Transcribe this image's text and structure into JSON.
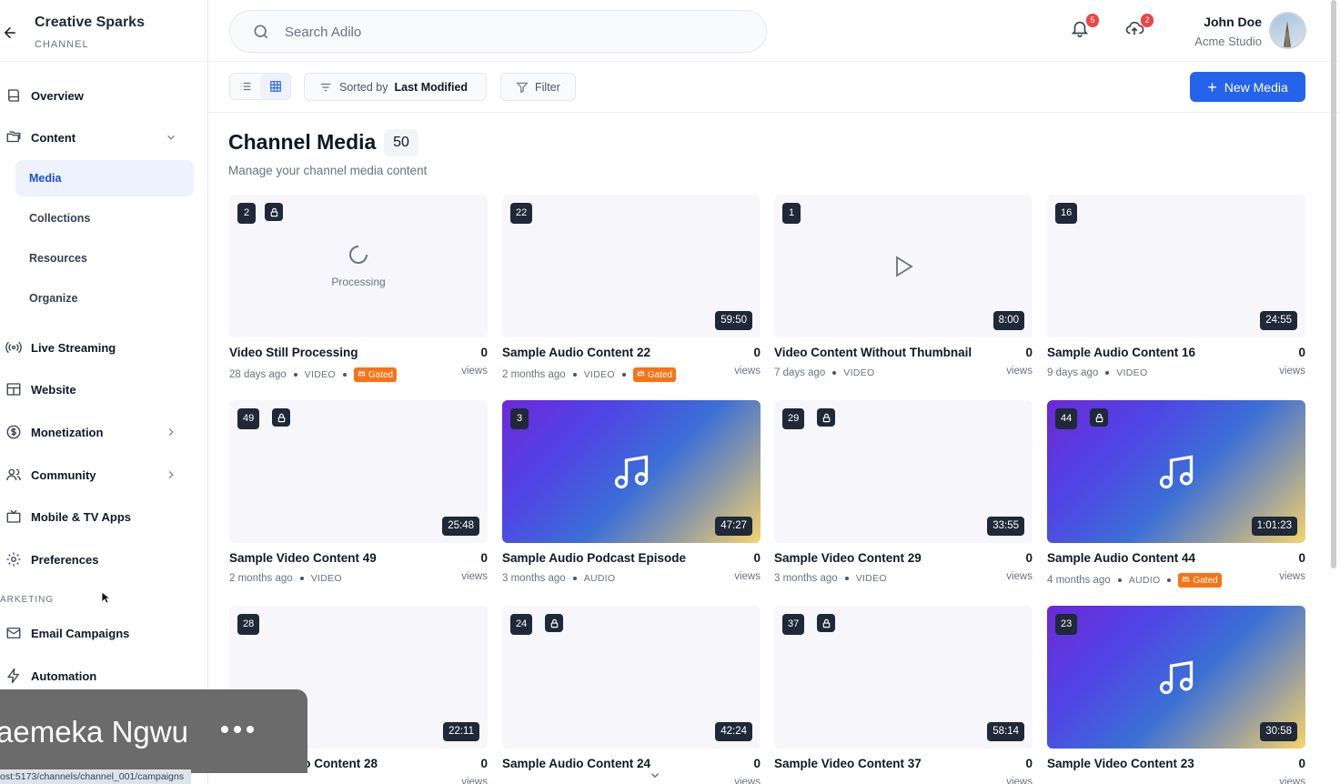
{
  "sidebar": {
    "brand_title": "Creative Sparks",
    "brand_sub": "CHANNEL",
    "items": [
      {
        "label": "Overview",
        "icon": "book-icon"
      },
      {
        "label": "Content",
        "icon": "folders-icon"
      },
      {
        "label": "Live Streaming",
        "icon": "broadcast-icon"
      },
      {
        "label": "Website",
        "icon": "layout-icon"
      },
      {
        "label": "Monetization",
        "icon": "dollar-icon"
      },
      {
        "label": "Community",
        "icon": "users-icon"
      },
      {
        "label": "Mobile & TV Apps",
        "icon": "tv-icon"
      },
      {
        "label": "Preferences",
        "icon": "gear-icon"
      },
      {
        "label": "Email Campaigns",
        "icon": "mail-icon"
      },
      {
        "label": "Automation",
        "icon": "bolt-icon"
      }
    ],
    "content_sub": [
      "Media",
      "Collections",
      "Resources",
      "Organize"
    ],
    "section_marketing": "ARKETING"
  },
  "header": {
    "search_placeholder": "Search Adilo",
    "notifications_count": "5",
    "uploads_count": "2",
    "user_name": "John Doe",
    "user_org": "Acme Studio"
  },
  "toolbar": {
    "sort_prefix": "Sorted by",
    "sort_value": "Last Modified",
    "filter_label": "Filter",
    "new_media_label": "New Media"
  },
  "main": {
    "title": "Channel Media",
    "count": "50",
    "subtitle": "Manage your channel media content",
    "views_label": "views",
    "processing_label": "Processing",
    "gated_label": "Gated"
  },
  "media": [
    {
      "num": "2",
      "title": "Video Still Processing",
      "views": "0",
      "age": "28 days ago",
      "type": "VIDEO",
      "gated": true,
      "locked": true,
      "duration": "",
      "thumb": "processing"
    },
    {
      "num": "22",
      "title": "Sample Audio Content 22",
      "views": "0",
      "age": "2 months ago",
      "type": "VIDEO",
      "gated": true,
      "locked": false,
      "duration": "59:50",
      "thumb": "blank"
    },
    {
      "num": "1",
      "title": "Video Content Without Thumbnail",
      "views": "0",
      "age": "7 days ago",
      "type": "VIDEO",
      "gated": false,
      "locked": false,
      "duration": "8:00",
      "thumb": "play"
    },
    {
      "num": "16",
      "title": "Sample Audio Content 16",
      "views": "0",
      "age": "9 days ago",
      "type": "VIDEO",
      "gated": false,
      "locked": false,
      "duration": "24:55",
      "thumb": "blank"
    },
    {
      "num": "49",
      "title": "Sample Video Content 49",
      "views": "0",
      "age": "2 months ago",
      "type": "VIDEO",
      "gated": false,
      "locked": true,
      "duration": "25:48",
      "thumb": "blank"
    },
    {
      "num": "3",
      "title": "Sample Audio Podcast Episode",
      "views": "0",
      "age": "3 months ago",
      "type": "AUDIO",
      "gated": false,
      "locked": false,
      "duration": "47:27",
      "thumb": "audio"
    },
    {
      "num": "29",
      "title": "Sample Video Content 29",
      "views": "0",
      "age": "3 months ago",
      "type": "VIDEO",
      "gated": false,
      "locked": true,
      "duration": "33:55",
      "thumb": "blank"
    },
    {
      "num": "44",
      "title": "Sample Audio Content 44",
      "views": "0",
      "age": "4 months ago",
      "type": "AUDIO",
      "gated": true,
      "locked": true,
      "duration": "1:01:23",
      "thumb": "audio"
    },
    {
      "num": "28",
      "title": "Sample Audio Content 28",
      "views": "0",
      "age": "",
      "type": "",
      "gated": false,
      "locked": false,
      "duration": "22:11",
      "thumb": "blank"
    },
    {
      "num": "24",
      "title": "Sample Audio Content 24",
      "views": "0",
      "age": "",
      "type": "",
      "gated": false,
      "locked": true,
      "duration": "42:24",
      "thumb": "blank"
    },
    {
      "num": "37",
      "title": "Sample Video Content 37",
      "views": "0",
      "age": "",
      "type": "",
      "gated": false,
      "locked": true,
      "duration": "58:14",
      "thumb": "blank"
    },
    {
      "num": "23",
      "title": "Sample Video Content 23",
      "views": "0",
      "age": "",
      "type": "",
      "gated": false,
      "locked": false,
      "duration": "30:58",
      "thumb": "audio"
    }
  ],
  "overlay": {
    "participant_name": "aemeka Ngwu",
    "status_url": "ost:5173/channels/channel_001/campaigns"
  },
  "colors": {
    "accent": "#2563eb",
    "active_bg": "#eef2ff",
    "gated": "#f97316",
    "badge": "#ef4444"
  }
}
